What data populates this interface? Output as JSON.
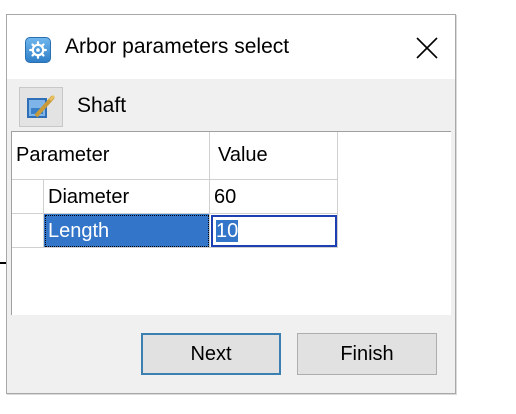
{
  "window": {
    "title": "Arbor parameters select",
    "app_icon": "gear-settings-icon",
    "close_icon": "close-x-icon"
  },
  "toolbar": {
    "shaft_label": "Shaft",
    "shaft_icon": "shaft-edit-icon"
  },
  "grid": {
    "columns": [
      "Parameter",
      "Value"
    ],
    "rows": [
      {
        "parameter": "Diameter",
        "value": "60",
        "selected": false
      },
      {
        "parameter": "Length",
        "value": "10",
        "selected": true
      }
    ]
  },
  "buttons": {
    "next_label": "Next",
    "finish_label": "Finish"
  },
  "colors": {
    "selection": "#3375c9",
    "focus_border": "#1d3fb4"
  }
}
